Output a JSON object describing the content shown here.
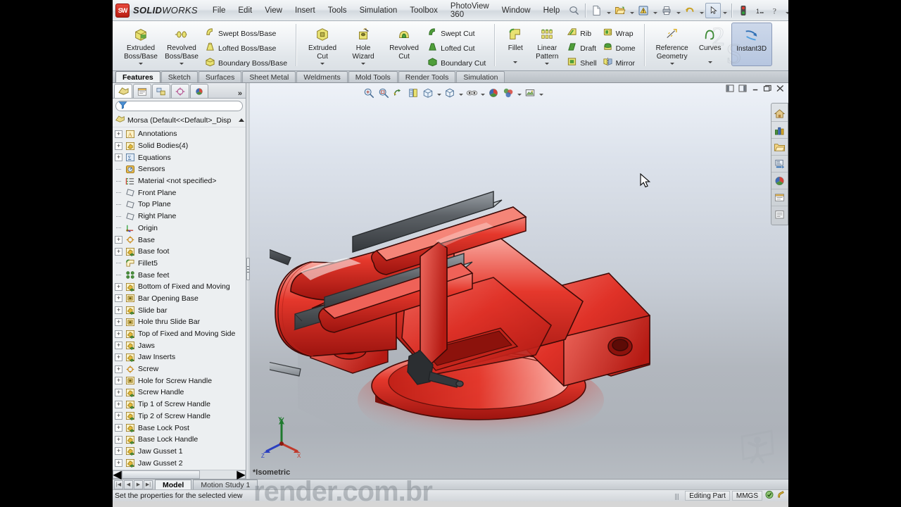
{
  "app": {
    "brand_name_bold": "SOLID",
    "brand_name_light": "WORKS",
    "brand_mark": "SW",
    "accent_color": "#c0241a",
    "viewport_bg_top": "#eef2f8",
    "viewport_bg_bottom": "#b7bcc2"
  },
  "menu": {
    "items": [
      "File",
      "Edit",
      "View",
      "Insert",
      "Tools",
      "Simulation",
      "Toolbox",
      "PhotoView 360",
      "Window",
      "Help"
    ],
    "quick_access": [
      {
        "name": "new-document-icon",
        "label": "New"
      },
      {
        "name": "open-document-icon",
        "label": "Open"
      },
      {
        "name": "save-icon",
        "label": "Save"
      },
      {
        "name": "print-icon",
        "label": "Print"
      },
      {
        "name": "undo-icon",
        "label": "Undo"
      },
      {
        "name": "select-icon",
        "label": "Select"
      },
      {
        "name": "rebuild-icon",
        "label": "Rebuild"
      },
      {
        "name": "options-icon",
        "label": "Options"
      },
      {
        "name": "help-icon",
        "label": "Help"
      }
    ],
    "window_buttons": [
      "minimize",
      "restore",
      "close"
    ]
  },
  "ribbon": {
    "groups": [
      {
        "big": [
          {
            "label_line1": "Extruded",
            "label_line2": "Boss/Base",
            "icon": "extruded-boss-icon",
            "dropdown": true
          },
          {
            "label_line1": "Revolved",
            "label_line2": "Boss/Base",
            "icon": "revolved-boss-icon",
            "dropdown": true
          }
        ],
        "small": [
          {
            "label": "Swept Boss/Base",
            "icon": "swept-boss-icon"
          },
          {
            "label": "Lofted Boss/Base",
            "icon": "lofted-boss-icon"
          },
          {
            "label": "Boundary Boss/Base",
            "icon": "boundary-boss-icon"
          }
        ]
      },
      {
        "big": [
          {
            "label_line1": "Extruded",
            "label_line2": "Cut",
            "icon": "extruded-cut-icon",
            "dropdown": true
          },
          {
            "label_line1": "Hole",
            "label_line2": "Wizard",
            "icon": "hole-wizard-icon",
            "dropdown": true
          },
          {
            "label_line1": "Revolved",
            "label_line2": "Cut",
            "icon": "revolved-cut-icon",
            "dropdown": false
          }
        ],
        "small": [
          {
            "label": "Swept Cut",
            "icon": "swept-cut-icon"
          },
          {
            "label": "Lofted Cut",
            "icon": "lofted-cut-icon"
          },
          {
            "label": "Boundary Cut",
            "icon": "boundary-cut-icon"
          }
        ]
      },
      {
        "big": [
          {
            "label_line1": "Fillet",
            "label_line2": "",
            "icon": "fillet-icon",
            "dropdown": true
          },
          {
            "label_line1": "Linear",
            "label_line2": "Pattern",
            "icon": "linear-pattern-icon",
            "dropdown": true
          }
        ],
        "small": [
          {
            "label": "Rib",
            "icon": "rib-icon"
          },
          {
            "label": "Draft",
            "icon": "draft-icon"
          },
          {
            "label": "Shell",
            "icon": "shell-icon"
          }
        ],
        "small2": [
          {
            "label": "Wrap",
            "icon": "wrap-icon"
          },
          {
            "label": "Dome",
            "icon": "dome-icon"
          },
          {
            "label": "Mirror",
            "icon": "mirror-icon"
          }
        ]
      },
      {
        "big": [
          {
            "label_line1": "Reference",
            "label_line2": "Geometry",
            "icon": "reference-geometry-icon",
            "dropdown": true
          },
          {
            "label_line1": "Curves",
            "label_line2": "",
            "icon": "curves-icon",
            "dropdown": true
          }
        ]
      }
    ],
    "instant3d": {
      "label": "Instant3D",
      "icon": "instant3d-icon",
      "active": true
    }
  },
  "command_tabs": {
    "items": [
      "Features",
      "Sketch",
      "Surfaces",
      "Sheet Metal",
      "Weldments",
      "Mold Tools",
      "Render Tools",
      "Simulation"
    ],
    "active": "Features"
  },
  "feature_manager": {
    "tabs": [
      {
        "name": "feature-tree-tab",
        "icon": "feature-tree-icon",
        "active": true
      },
      {
        "name": "property-manager-tab",
        "icon": "property-manager-icon",
        "active": false
      },
      {
        "name": "configuration-manager-tab",
        "icon": "configuration-manager-icon",
        "active": false
      },
      {
        "name": "dimxpert-manager-tab",
        "icon": "dimxpert-icon",
        "active": false
      },
      {
        "name": "display-manager-tab",
        "icon": "display-manager-icon",
        "active": false
      }
    ],
    "more_label": "»",
    "filter_placeholder": "",
    "root_label": "Morsa  (Default<<Default>_Disp",
    "tree": [
      {
        "label": "Annotations",
        "icon": "annotations-icon",
        "expandable": true,
        "indent": 0
      },
      {
        "label": "Solid Bodies(4)",
        "icon": "solid-bodies-icon",
        "expandable": true,
        "indent": 0
      },
      {
        "label": "Equations",
        "icon": "equations-icon",
        "expandable": true,
        "indent": 0
      },
      {
        "label": "Sensors",
        "icon": "sensors-icon",
        "expandable": false,
        "indent": 0
      },
      {
        "label": "Material <not specified>",
        "icon": "material-icon",
        "expandable": false,
        "indent": 0
      },
      {
        "label": "Front Plane",
        "icon": "plane-icon",
        "expandable": false,
        "indent": 0
      },
      {
        "label": "Top Plane",
        "icon": "plane-icon",
        "expandable": false,
        "indent": 0
      },
      {
        "label": "Right Plane",
        "icon": "plane-icon",
        "expandable": false,
        "indent": 0
      },
      {
        "label": "Origin",
        "icon": "origin-icon",
        "expandable": false,
        "indent": 0
      },
      {
        "label": "Base",
        "icon": "sketch-feature-icon",
        "expandable": true,
        "indent": 0
      },
      {
        "label": "Base foot",
        "icon": "boss-extrude-icon",
        "expandable": true,
        "indent": 0
      },
      {
        "label": "Fillet5",
        "icon": "fillet-feature-icon",
        "expandable": false,
        "indent": 0
      },
      {
        "label": "Base feet",
        "icon": "pattern-feature-icon",
        "expandable": false,
        "indent": 0
      },
      {
        "label": "Bottom of Fixed and Moving",
        "icon": "boss-extrude-icon",
        "expandable": true,
        "indent": 0
      },
      {
        "label": "Bar Opening Base",
        "icon": "cut-extrude-icon",
        "expandable": true,
        "indent": 0
      },
      {
        "label": "Slide bar",
        "icon": "boss-extrude-icon",
        "expandable": true,
        "indent": 0
      },
      {
        "label": "Hole thru Slide Bar",
        "icon": "cut-extrude-icon",
        "expandable": true,
        "indent": 0
      },
      {
        "label": "Top of Fixed and Moving Side",
        "icon": "boss-extrude-icon",
        "expandable": true,
        "indent": 0
      },
      {
        "label": "Jaws",
        "icon": "boss-extrude-icon",
        "expandable": true,
        "indent": 0
      },
      {
        "label": "Jaw Inserts",
        "icon": "boss-extrude-icon",
        "expandable": true,
        "indent": 0
      },
      {
        "label": "Screw",
        "icon": "sketch-feature-icon",
        "expandable": true,
        "indent": 0
      },
      {
        "label": "Hole for Screw Handle",
        "icon": "cut-extrude-icon",
        "expandable": true,
        "indent": 0
      },
      {
        "label": "Screw Handle",
        "icon": "boss-extrude-icon",
        "expandable": true,
        "indent": 0
      },
      {
        "label": "Tip 1 of Screw Handle",
        "icon": "boss-extrude-icon",
        "expandable": true,
        "indent": 0
      },
      {
        "label": "Tip 2 of Screw Handle",
        "icon": "boss-extrude-icon",
        "expandable": true,
        "indent": 0
      },
      {
        "label": "Base Lock Post",
        "icon": "boss-extrude-icon",
        "expandable": true,
        "indent": 0
      },
      {
        "label": "Base Lock Handle",
        "icon": "boss-extrude-icon",
        "expandable": true,
        "indent": 0
      },
      {
        "label": "Jaw Gusset 1",
        "icon": "boss-extrude-icon",
        "expandable": true,
        "indent": 0
      },
      {
        "label": "Jaw Gusset 2",
        "icon": "boss-extrude-icon",
        "expandable": true,
        "indent": 0
      }
    ]
  },
  "viewport": {
    "heads_up_toolbar": [
      {
        "name": "zoom-to-fit-icon",
        "dropdown": false
      },
      {
        "name": "zoom-to-area-icon",
        "dropdown": false
      },
      {
        "name": "previous-view-icon",
        "dropdown": false
      },
      {
        "name": "section-view-icon",
        "dropdown": false
      },
      {
        "name": "view-orientation-icon",
        "dropdown": true
      },
      {
        "name": "display-style-icon",
        "dropdown": true
      },
      {
        "name": "hide-show-items-icon",
        "dropdown": true
      },
      {
        "name": "edit-appearance-icon",
        "dropdown": false
      },
      {
        "name": "apply-scene-icon",
        "dropdown": true
      },
      {
        "name": "view-settings-icon",
        "dropdown": true
      }
    ],
    "window_controls": [
      "split-horizontal",
      "split-vertical",
      "minimize",
      "restore",
      "close"
    ],
    "view_label": "*Isometric",
    "triad_axes": [
      "X",
      "Y",
      "Z"
    ],
    "model_name": "bench-vise",
    "model_color": "#d8251f",
    "watermark": "render.com.br"
  },
  "task_pane": {
    "buttons": [
      {
        "name": "solidworks-resources-icon",
        "label": "SolidWorks Resources"
      },
      {
        "name": "design-library-icon",
        "label": "Design Library"
      },
      {
        "name": "file-explorer-icon",
        "label": "File Explorer"
      },
      {
        "name": "search-icon",
        "label": "Search"
      },
      {
        "name": "view-palette-icon",
        "label": "View Palette"
      },
      {
        "name": "appearances-scenes-icon",
        "label": "Appearances, Scenes and Decals"
      },
      {
        "name": "custom-properties-icon",
        "label": "Custom Properties"
      }
    ]
  },
  "bottom": {
    "nav_buttons": [
      "first",
      "previous",
      "next",
      "last"
    ],
    "tabs": [
      "Model",
      "Motion Study 1"
    ],
    "active_tab": "Model",
    "status_message": "Set the properties for the selected view",
    "status_right": [
      "Editing Part",
      "MMGS"
    ]
  }
}
